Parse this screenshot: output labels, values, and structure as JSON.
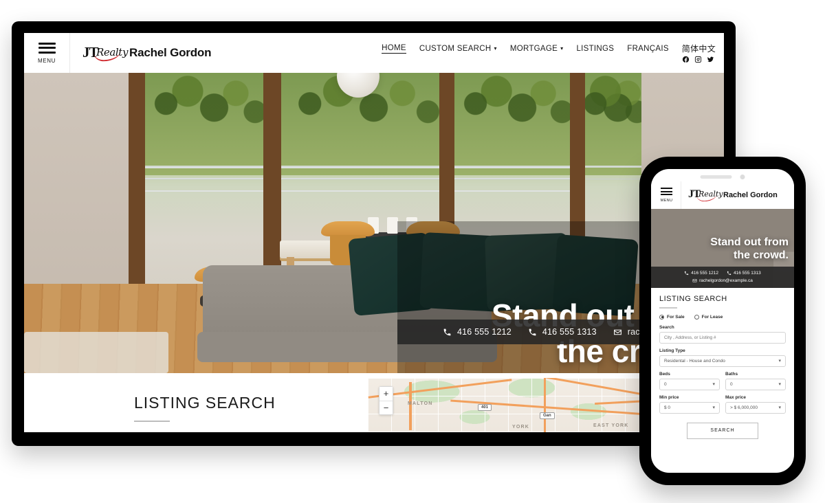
{
  "site": {
    "brand_name": "Rachel Gordon",
    "logo_jt": "JT",
    "logo_realty": "Realty",
    "menu_label": "MENU"
  },
  "nav": {
    "items": [
      {
        "label": "HOME",
        "caret": "",
        "active": true
      },
      {
        "label": "CUSTOM SEARCH",
        "caret": "⌄",
        "active": false
      },
      {
        "label": "MORTGAGE",
        "caret": "⌄",
        "active": false
      },
      {
        "label": "LISTINGS",
        "caret": "",
        "active": false
      },
      {
        "label": "FRANÇAIS",
        "caret": "",
        "active": false
      },
      {
        "label": "简体中文",
        "caret": "",
        "active": false
      }
    ],
    "socials": [
      "facebook-icon",
      "instagram-icon",
      "twitter-icon"
    ]
  },
  "hero": {
    "title_line1": "Stand out from",
    "title_line2": "the crowd.",
    "phone1": "416 555 1212",
    "phone2": "416 555 1313",
    "email": "rachelgordon@example.ca"
  },
  "listing_search": {
    "title": "LISTING SEARCH",
    "for_sale_label": "For Sale",
    "for_lease_label": "For Lease",
    "for_sale_selected": true,
    "search_label": "Search",
    "search_placeholder": "City , Address, or Listing #",
    "search_value": "",
    "listing_type_label": "Listing Type",
    "listing_type_value": "Residental - House and Condo",
    "beds_label": "Beds",
    "beds_value": "0",
    "baths_label": "Baths",
    "baths_value": "0",
    "min_price_label": "Min price",
    "min_price_value": "$ 0",
    "max_price_label": "Max price",
    "max_price_value": "> $ 6,000,000",
    "search_button": "SEARCH"
  },
  "map": {
    "zoom_in": "+",
    "zoom_out": "−",
    "labels": [
      "MALTON",
      "YORK",
      "EAST YORK"
    ],
    "shields": [
      "401",
      "Gan"
    ]
  },
  "colors": {
    "accent_red": "#d0282e",
    "overlay_dark": "#262626",
    "text_dark": "#1a1a1a"
  }
}
